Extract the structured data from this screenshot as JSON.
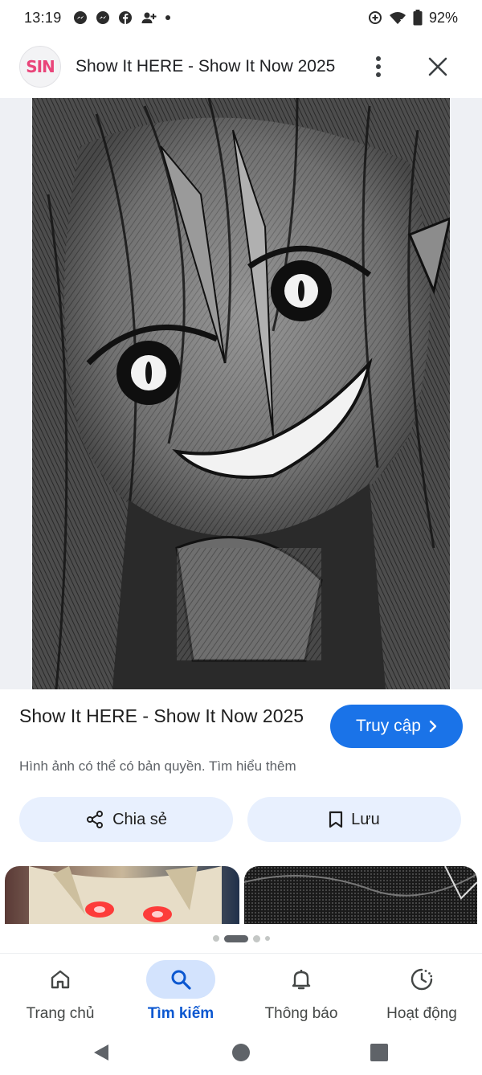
{
  "status_bar": {
    "time": "13:19",
    "battery": "92%",
    "notification_icons": [
      "messenger-icon",
      "messenger-icon",
      "facebook-icon",
      "person-add-icon",
      "dot-icon"
    ],
    "system_icons": [
      "data-saver-icon",
      "wifi-icon",
      "battery-icon"
    ]
  },
  "header": {
    "site_logo_text": "SIN",
    "title": "Show It HERE - Show It Now 2025"
  },
  "result": {
    "title": "Show It HERE - Show It Now 2025",
    "visit_label": "Truy cập",
    "copyright_text": "Hình ảnh có thể có bản quyền.",
    "learn_more": "Tìm hiểu thêm"
  },
  "actions": {
    "share_label": "Chia sẻ",
    "save_label": "Lưu"
  },
  "pager": {
    "current": 2,
    "total": 4
  },
  "bottom_nav": {
    "items": [
      {
        "label": "Trang chủ",
        "icon": "home-icon"
      },
      {
        "label": "Tìm kiếm",
        "icon": "search-icon",
        "active": true
      },
      {
        "label": "Thông báo",
        "icon": "bell-icon"
      },
      {
        "label": "Hoạt động",
        "icon": "activity-icon"
      }
    ]
  },
  "colors": {
    "accent": "#1a73e8",
    "active_nav": "#0b57d0",
    "tonal_button": "#e8f0fe",
    "active_pill": "#d3e3fd"
  }
}
